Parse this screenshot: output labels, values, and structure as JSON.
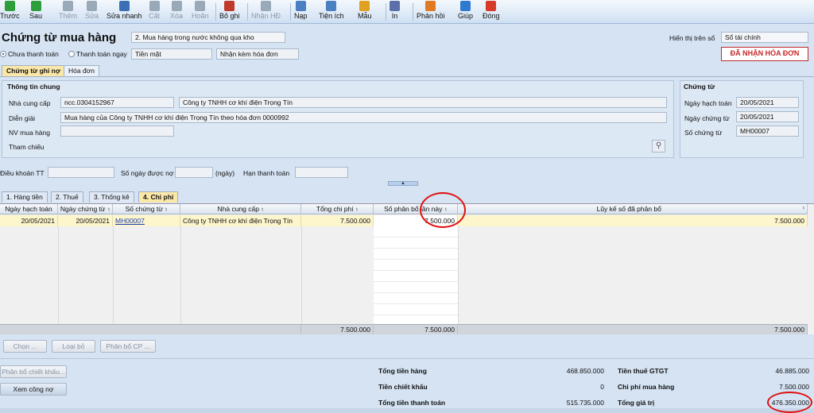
{
  "toolbar": {
    "items": [
      {
        "label": "Trước",
        "color": "#2e9e3c",
        "disabled": false
      },
      {
        "label": "Sau",
        "color": "#2e9e3c",
        "disabled": false
      },
      {
        "label": "Thêm",
        "color": "#9aa9b8",
        "disabled": true
      },
      {
        "label": "Sửa",
        "color": "#9aa9b8",
        "disabled": true
      },
      {
        "label": "Sửa nhanh",
        "color": "#3b6fb5",
        "disabled": false
      },
      {
        "label": "Cất",
        "color": "#9aa9b8",
        "disabled": true
      },
      {
        "label": "Xóa",
        "color": "#9aa9b8",
        "disabled": true
      },
      {
        "label": "Hoãn",
        "color": "#9aa9b8",
        "disabled": true
      },
      {
        "label": "Bỏ ghi",
        "color": "#c0392b",
        "disabled": false
      },
      {
        "label": "Nhận HĐ",
        "color": "#9aa9b8",
        "disabled": true
      },
      {
        "label": "Nạp",
        "color": "#4a7fc1",
        "disabled": false
      },
      {
        "label": "Tiện ích",
        "color": "#4a7fc1",
        "disabled": false
      },
      {
        "label": "Mẫu",
        "color": "#e0a020",
        "disabled": false
      },
      {
        "label": "In",
        "color": "#5b6fa8",
        "disabled": false
      },
      {
        "label": "Phản hồi",
        "color": "#e07a20",
        "disabled": false
      },
      {
        "label": "Giúp",
        "color": "#2f7ad1",
        "disabled": false
      },
      {
        "label": "Đóng",
        "color": "#d83a2a",
        "disabled": false
      }
    ]
  },
  "header": {
    "title": "Chứng từ mua hàng",
    "type_select": "2. Mua hàng trong nước không qua kho",
    "radio_unpaid": "Chưa thanh toán",
    "radio_paid": "Thanh toán ngay",
    "payment_method": "Tiền mặt",
    "invoice_option": "Nhận kèm hóa đơn",
    "display_label": "Hiển thị trên sổ",
    "display_value": "Sổ tài chính",
    "invoice_status": "ĐÃ NHẬN HÓA ĐƠN"
  },
  "tabs_top": [
    "Chứng từ ghi nợ",
    "Hóa đơn"
  ],
  "general": {
    "group_title": "Thông tin chung",
    "supplier_label": "Nhà cung cấp",
    "supplier_code": "ncc.0304152967",
    "supplier_name": "Công ty TNHH cơ khí điện Trọng Tín",
    "description_label": "Diễn giải",
    "description": "Mua hàng của Công ty TNHH cơ khí điện Trọng Tín theo hóa đơn 0000992",
    "buyer_label": "NV mua hàng",
    "buyer": "",
    "reference_label": "Tham chiếu"
  },
  "voucher": {
    "group_title": "Chứng từ",
    "posting_date_label": "Ngày hạch toán",
    "posting_date": "20/05/2021",
    "voucher_date_label": "Ngày chứng từ",
    "voucher_date": "20/05/2021",
    "voucher_no_label": "Số chứng từ",
    "voucher_no": "MH00007"
  },
  "terms": {
    "payment_terms_label": "Điều khoản TT",
    "days_label": "Số ngày được nợ",
    "days_unit": "(ngày)",
    "due_date_label": "Hạn thanh toán"
  },
  "detail_tabs": [
    "1. Hàng tiền",
    "2. Thuế",
    "3. Thống kê",
    "4. Chi phí"
  ],
  "grid": {
    "columns": [
      "Ngày hạch toán",
      "Ngày chứng từ",
      "Số chứng từ",
      "Nhà cung cấp",
      "Tổng chi phí",
      "Số phân bổ lần này",
      "Lũy kế số đã phân bổ"
    ],
    "row": [
      "20/05/2021",
      "20/05/2021",
      "MH00007",
      "Công ty TNHH cơ khí điện Trọng Tín",
      "7.500.000",
      "7.500.000",
      "7.500.000"
    ],
    "footer": [
      "7.500.000",
      "7.500.000",
      "7.500.000"
    ]
  },
  "actions": {
    "choose": "Chọn ...",
    "remove": "Loại bỏ",
    "allocate": "Phân bổ CP ...",
    "discount": "Phân bổ chiết khấu...",
    "view_debt": "Xem công nợ"
  },
  "totals": {
    "goods_label": "Tổng tiền hàng",
    "goods": "468.850.000",
    "discount_label": "Tiền chiết khấu",
    "discount": "0",
    "payment_label": "Tổng tiền thanh toán",
    "payment": "515.735.000",
    "vat_label": "Tiền thuế GTGT",
    "vat": "46.885.000",
    "cost_label": "Chi phí mua hàng",
    "cost": "7.500.000",
    "value_label": "Tổng giá trị",
    "value": "476.350.000"
  }
}
